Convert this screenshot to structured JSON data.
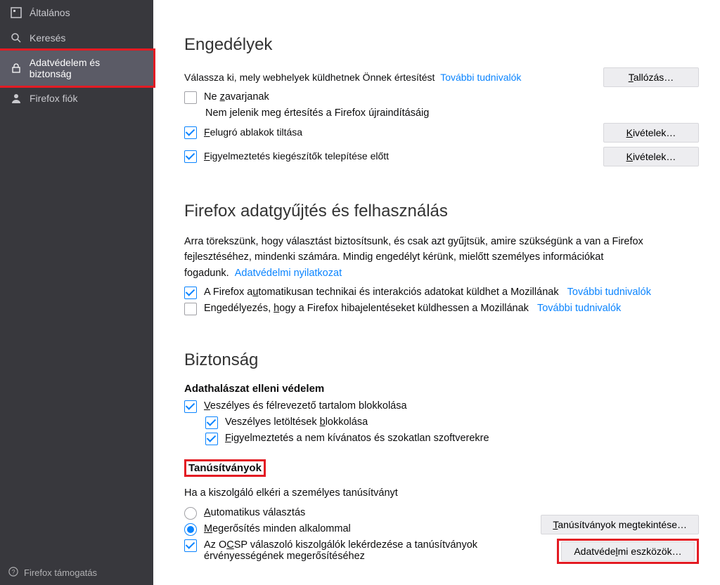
{
  "sidebar": {
    "items": [
      {
        "label": "Általános"
      },
      {
        "label": "Keresés"
      },
      {
        "label": "Adatvédelem és biztonság"
      },
      {
        "label": "Firefox fiók"
      }
    ],
    "footer": "Firefox támogatás"
  },
  "permissions": {
    "title": "Engedélyek",
    "notify_desc": "Válassza ki, mely webhelyek küldhetnek Önnek értesítést",
    "learn_more": "További tudnivalók",
    "browse_btn": "Tallózás…",
    "dnd_label": "Ne zavarjanak",
    "dnd_sub": "Nem jelenik meg értesítés a Firefox újraindításáig",
    "popup_label": "Felugró ablakok tiltása",
    "exceptions_btn": "Kivételek…",
    "addon_label": "Figyelmeztetés kiegészítők telepítése előtt"
  },
  "data_collection": {
    "title": "Firefox adatgyűjtés és felhasználás",
    "desc": "Arra törekszünk, hogy választást biztosítsunk, és csak azt gyűjtsük, amire szükségünk a van a Firefox fejlesztéséhez, mindenki számára. Mindig engedélyt kérünk, mielőtt személyes információkat fogadunk.",
    "privacy_notice": "Adatvédelmi nyilatkozat",
    "telemetry_label": "A Firefox automatikusan technikai és interakciós adatokat küldhet a Mozillának",
    "learn_more": "További tudnivalók",
    "crash_label": "Engedélyezés, hogy a Firefox hibajelentéseket küldhessen a Mozillának"
  },
  "security": {
    "title": "Biztonság",
    "phishing_header": "Adathalászat elleni védelem",
    "block_dangerous": "Veszélyes és félrevezető tartalom blokkolása",
    "block_downloads": "Veszélyes letöltések blokkolása",
    "warn_unwanted": "Figyelmeztetés a nem kívánatos és szokatlan szoftverekre",
    "certs_header": "Tanúsítványok",
    "certs_desc": "Ha a kiszolgáló elkéri a személyes tanúsítványt",
    "radio_auto": "Automatikus választás",
    "radio_ask": "Megerősítés minden alkalommal",
    "ocsp_label": "Az OCSP válaszoló kiszolgálók lekérdezése a tanúsítványok érvényességének megerősítéséhez",
    "view_certs_btn": "Tanúsítványok megtekintése…",
    "sec_devices_btn": "Adatvédelmi eszközök…"
  }
}
